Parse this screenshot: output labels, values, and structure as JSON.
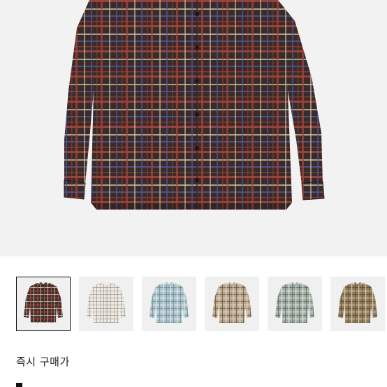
{
  "product": {
    "main_image": {
      "icon": "plaid-shirt-image",
      "plaid": {
        "base": "#3b2b27",
        "line1": "#a8453d",
        "line2": "#cfc7b8",
        "line3": "#4f57a0"
      }
    }
  },
  "colors": [
    {
      "name": "brown-plaid",
      "selected": true,
      "base": "#3e2f2a",
      "l1": "#a3453c",
      "l2": "#d6cfc0"
    },
    {
      "name": "white-plaid",
      "selected": false,
      "base": "#eceae4",
      "l1": "#c7b9a7",
      "l2": "#9e9a94"
    },
    {
      "name": "blue-plaid",
      "selected": false,
      "base": "#a9c1c8",
      "l1": "#e7ecea",
      "l2": "#6d8c99"
    },
    {
      "name": "beige-plaid",
      "selected": false,
      "base": "#b9a58c",
      "l1": "#e6dccd",
      "l2": "#6e5a48"
    },
    {
      "name": "grey-plaid",
      "selected": false,
      "base": "#9eaba0",
      "l1": "#e8e6d8",
      "l2": "#5a6b74"
    },
    {
      "name": "olive-plaid",
      "selected": false,
      "base": "#8f7a5c",
      "l1": "#d9c9a8",
      "l2": "#5b4a35"
    }
  ],
  "purchase": {
    "instant_buy_label": "즉시 구매가"
  }
}
